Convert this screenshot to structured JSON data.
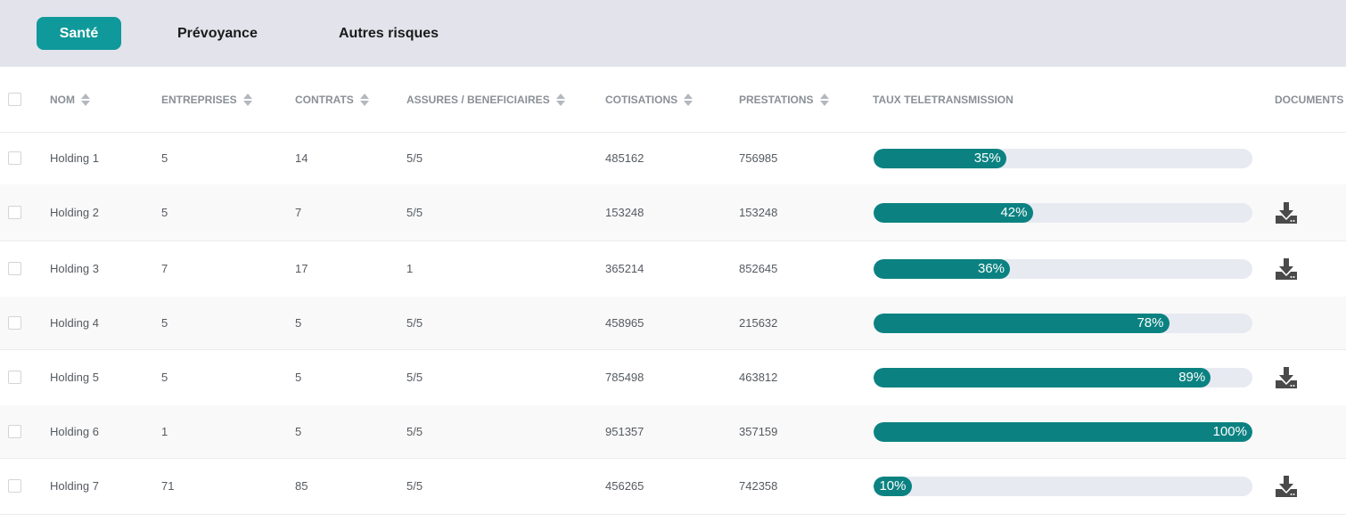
{
  "tabs": [
    {
      "label": "Santé",
      "active": true
    },
    {
      "label": "Prévoyance",
      "active": false
    },
    {
      "label": "Autres risques",
      "active": false
    }
  ],
  "columns": {
    "nom": "NOM",
    "entreprises": "ENTREPRISES",
    "contrats": "CONTRATS",
    "assures": "ASSURES / BENEFICIAIRES",
    "cotisations": "COTISATIONS",
    "prestations": "PRESTATIONS",
    "taux": "TAUX TELETRANSMISSION",
    "documents": "DOCUMENTS"
  },
  "rows": [
    {
      "nom": "Holding 1",
      "entreprises": "5",
      "contrats": "14",
      "assures": "5/5",
      "cotisations": "485162",
      "prestations": "756985",
      "taux": 35,
      "taux_label": "35%",
      "document": false
    },
    {
      "nom": "Holding 2",
      "entreprises": "5",
      "contrats": "7",
      "assures": "5/5",
      "cotisations": "153248",
      "prestations": "153248",
      "taux": 42,
      "taux_label": "42%",
      "document": true
    },
    {
      "nom": "Holding 3",
      "entreprises": "7",
      "contrats": "17",
      "assures": "1",
      "cotisations": "365214",
      "prestations": "852645",
      "taux": 36,
      "taux_label": "36%",
      "document": true
    },
    {
      "nom": "Holding 4",
      "entreprises": "5",
      "contrats": "5",
      "assures": "5/5",
      "cotisations": "458965",
      "prestations": "215632",
      "taux": 78,
      "taux_label": "78%",
      "document": false
    },
    {
      "nom": "Holding 5",
      "entreprises": "5",
      "contrats": "5",
      "assures": "5/5",
      "cotisations": "785498",
      "prestations": "463812",
      "taux": 89,
      "taux_label": "89%",
      "document": true
    },
    {
      "nom": "Holding 6",
      "entreprises": "1",
      "contrats": "5",
      "assures": "5/5",
      "cotisations": "951357",
      "prestations": "357159",
      "taux": 100,
      "taux_label": "100%",
      "document": false
    },
    {
      "nom": "Holding 7",
      "entreprises": "71",
      "contrats": "85",
      "assures": "5/5",
      "cotisations": "456265",
      "prestations": "742358",
      "taux": 10,
      "taux_label": "10%",
      "document": true
    }
  ],
  "colors": {
    "accent": "#10999a",
    "progress": "#0b8281",
    "track": "#e8eaf2"
  },
  "icons": {
    "sort": "sort-icon",
    "download": "download-icon"
  }
}
